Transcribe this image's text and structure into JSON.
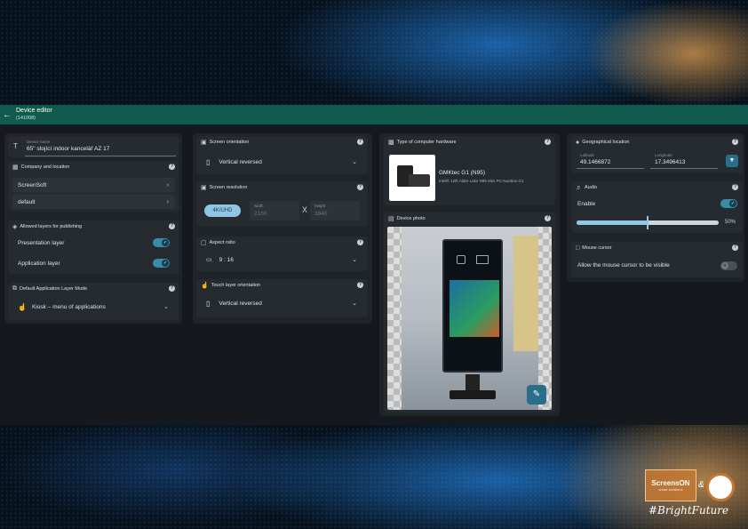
{
  "header": {
    "back_icon": "arrow-left-icon",
    "title": "Device editor",
    "subtitle": "(141008)"
  },
  "device_name": {
    "label": "Device name",
    "value": "65\" stojící indoor kancelář AZ 17"
  },
  "company": {
    "title": "Company and location",
    "company": "ScreenSoft",
    "location": "default"
  },
  "layers": {
    "title": "Allowed layers for publishing",
    "items": [
      {
        "label": "Presentation layer"
      },
      {
        "label": "Application layer"
      }
    ]
  },
  "app_mode": {
    "title": "Default Application Layer Mode",
    "value": "Kiosk – menu of applications"
  },
  "orientation": {
    "title": "Screen orientation",
    "value": "Vertical reversed"
  },
  "resolution": {
    "title": "Screen resolution",
    "preset": "4K/UHD",
    "width_label": "width",
    "width": "2160",
    "x": "X",
    "height_label": "height",
    "height": "3840"
  },
  "aspect": {
    "title": "Aspect ratio",
    "value": "9 : 16"
  },
  "touch": {
    "title": "Touch layer orientation",
    "value": "Vertical reversed"
  },
  "hardware": {
    "title": "Type of computer hardware",
    "name": "GMKtec G1 (N95)",
    "desc": "Intel® 12th Alder Lake N95 Mini PC-NucBox G1"
  },
  "photo": {
    "title": "Device photo"
  },
  "geo": {
    "title": "Geographical location",
    "lat_label": "Latitude",
    "lat": "49.1466872",
    "lon_label": "Longitude",
    "lon": "17.3496413"
  },
  "audio": {
    "title": "Audio",
    "enable": "Enable",
    "volume_text": "50%",
    "volume": 0.5
  },
  "mouse": {
    "title": "Mouse cursor",
    "allow": "Allow the mouse cursor to be visible"
  },
  "branding": {
    "logo": "ScreensON",
    "logo_sub": "smart solutions",
    "amp": "&",
    "tag": "#BrightFuture"
  },
  "colors": {
    "topbar": "#0f5a4c",
    "accent": "#3a8aa8",
    "card": "#262b30"
  }
}
